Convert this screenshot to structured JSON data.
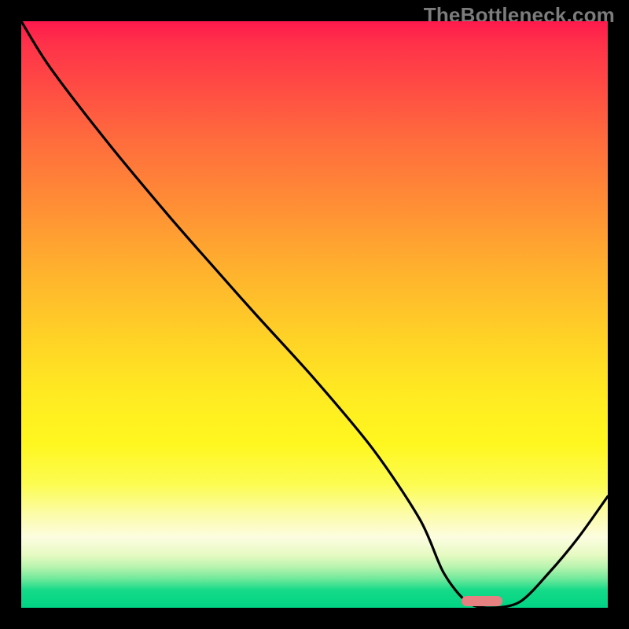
{
  "watermark": "TheBottleneck.com",
  "colors": {
    "frame_bg": "#000000",
    "curve_stroke": "#000000",
    "marker_fill": "#e78081",
    "watermark_text": "#7c7c7c"
  },
  "chart_data": {
    "type": "line",
    "title": "",
    "xlabel": "",
    "ylabel": "",
    "xlim": [
      0,
      100
    ],
    "ylim": [
      0,
      100
    ],
    "grid": false,
    "series": [
      {
        "name": "bottleneck-curve",
        "x": [
          0,
          5,
          15,
          25,
          32,
          40,
          50,
          60,
          68,
          72,
          76,
          80,
          85,
          90,
          95,
          100
        ],
        "values": [
          100,
          92,
          79,
          67,
          59,
          50,
          39,
          27,
          15,
          6,
          1,
          0,
          1,
          6,
          12,
          19
        ]
      }
    ],
    "marker": {
      "x_start": 75,
      "x_end": 82,
      "y": 0.5
    },
    "background_gradient": {
      "stops": [
        {
          "pos": 0.0,
          "color": "#ff1a4d"
        },
        {
          "pos": 0.3,
          "color": "#ff8a36"
        },
        {
          "pos": 0.6,
          "color": "#ffe922"
        },
        {
          "pos": 0.85,
          "color": "#fcfca8"
        },
        {
          "pos": 1.0,
          "color": "#00d484"
        }
      ]
    }
  }
}
